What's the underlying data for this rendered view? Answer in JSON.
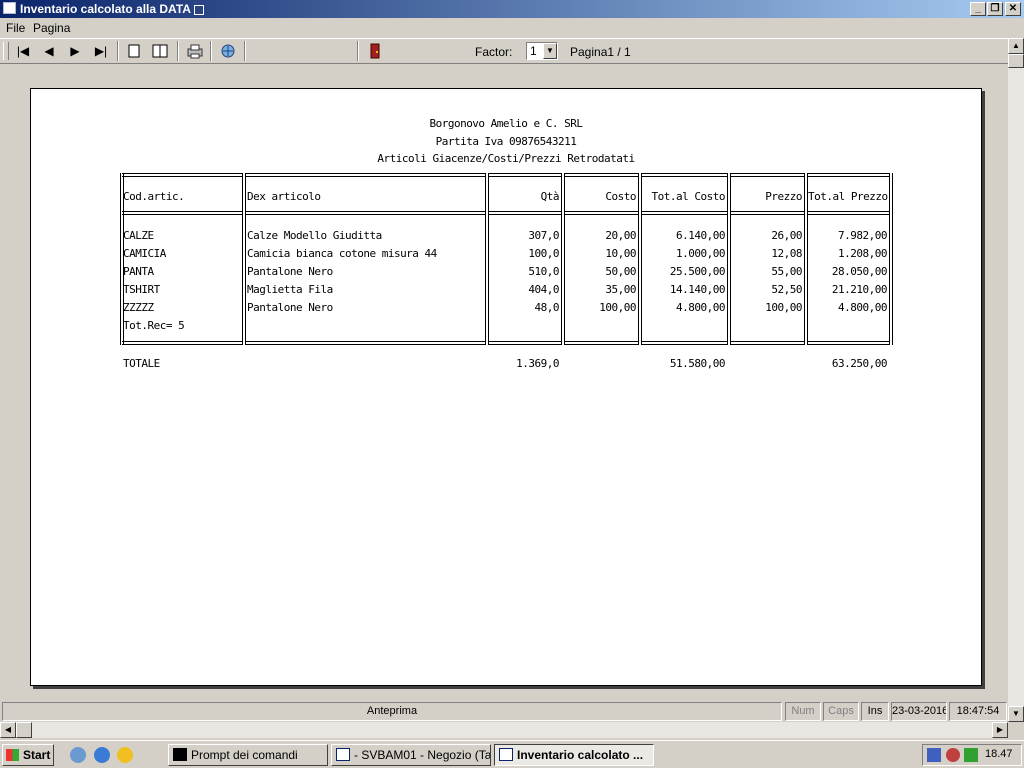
{
  "window": {
    "title": "Inventario calcolato alla DATA"
  },
  "menu": {
    "items": [
      "File",
      "Pagina"
    ]
  },
  "toolbar": {
    "factor_label": "Factor:",
    "factor_value": "1",
    "page_label": "Pagina1 / 1"
  },
  "report": {
    "company": "Borgonovo Amelio e C. SRL",
    "vat": "Partita Iva  09876543211",
    "subtitle": "Articoli Giacenze/Costi/Prezzi Retrodatati",
    "columns": [
      "Cod.artic.",
      "Dex articolo",
      "Qtà",
      "Costo",
      "Tot.al Costo",
      "Prezzo",
      "Tot.al Prezzo"
    ],
    "rows": [
      [
        "CALZE",
        "Calze Modello Giuditta",
        "307,0",
        "20,00",
        "6.140,00",
        "26,00",
        "7.982,00"
      ],
      [
        "CAMICIA",
        "Camicia bianca cotone misura 44",
        "100,0",
        "10,00",
        "1.000,00",
        "12,08",
        "1.208,00"
      ],
      [
        "PANTA",
        "Pantalone Nero",
        "510,0",
        "50,00",
        "25.500,00",
        "55,00",
        "28.050,00"
      ],
      [
        "TSHIRT",
        "Maglietta Fila",
        "404,0",
        "35,00",
        "14.140,00",
        "52,50",
        "21.210,00"
      ],
      [
        "ZZZZZ",
        "Pantalone Nero",
        "48,0",
        "100,00",
        "4.800,00",
        "100,00",
        "4.800,00"
      ]
    ],
    "tot_rec": "Tot.Rec= 5",
    "totals": {
      "label": "TOTALE",
      "qty": "1.369,0",
      "tot_cost": "51.580,00",
      "tot_price": "63.250,00"
    }
  },
  "status": {
    "mode": "Anteprima",
    "num": "Num",
    "caps": "Caps",
    "ins": "Ins",
    "date": "23-03-2016",
    "time": "18:47:54"
  },
  "taskbar": {
    "start": "Start",
    "tasks": [
      "Prompt dei comandi",
      "- SVBAM01 - Negozio (Ta...",
      "Inventario calcolato ..."
    ],
    "clock": "18.47"
  }
}
